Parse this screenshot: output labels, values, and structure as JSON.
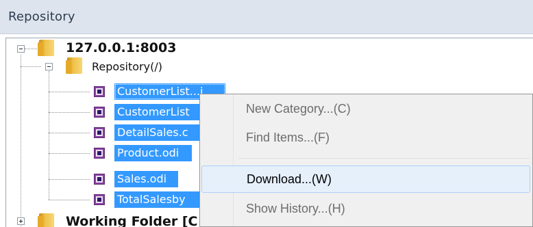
{
  "panel": {
    "title": "Repository"
  },
  "tree": {
    "root": {
      "label": "127.0.0.1:8003"
    },
    "repository": {
      "label": "Repository(/)"
    },
    "items": [
      {
        "label": "CustomerList...i"
      },
      {
        "label": "CustomerList"
      },
      {
        "label": "DetailSales.c"
      },
      {
        "label": "Product.odi"
      },
      {
        "label": "Sales.odi"
      },
      {
        "label": "TotalSalesby"
      }
    ],
    "working_folder": {
      "label": "Working Folder [C"
    }
  },
  "context_menu": {
    "items": [
      {
        "label": "New Category...(C)",
        "state": "disabled"
      },
      {
        "label": "Find Items...(F)",
        "state": "disabled"
      },
      {
        "label": "Download...(W)",
        "state": "hover"
      },
      {
        "label": "Show History...(H)",
        "state": "disabled"
      }
    ]
  },
  "colors": {
    "selection": "#3399ff",
    "header_bg": "#dde4ee",
    "menu_bg": "#f0f0f0",
    "menu_hover": "#e5f0fb"
  },
  "icons": {
    "expanded": "minus-box-icon",
    "collapsed": "plus-box-icon",
    "folder": "folder-icon",
    "report": "odi-report-icon"
  }
}
